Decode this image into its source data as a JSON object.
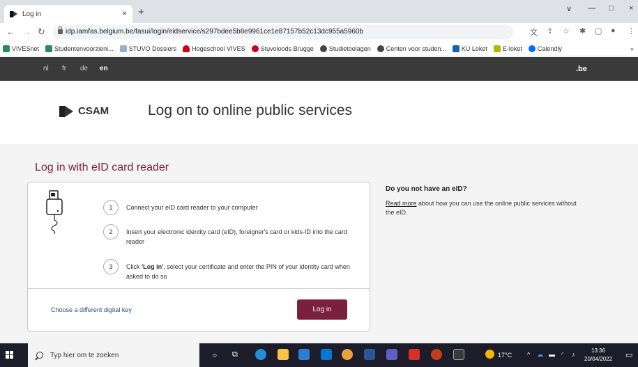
{
  "browser": {
    "tab_title": "Log in",
    "tab_close": "×",
    "new_tab": "+",
    "url": "idp.iamfas.belgium.be/fasui/login/eidservice/s297bdee5b8e9961ce1e87157b52c13dc955a5960b",
    "window_controls": [
      "∨",
      "—",
      "□",
      "×"
    ]
  },
  "bookmarks": [
    {
      "label": "VIVESnet",
      "color": "#2a8a5a"
    },
    {
      "label": "Studentenvoorzieni...",
      "color": "#2a8a5a"
    },
    {
      "label": "STUVO Dossiers",
      "color": "#9ab0c8"
    },
    {
      "label": "Hogeschool VIVES",
      "color": "#d0021b"
    },
    {
      "label": "Stuvoloods Brugge",
      "color": "#d0021b"
    },
    {
      "label": "Studietoelagen",
      "color": "#444444"
    },
    {
      "label": "Centen voor studen...",
      "color": "#444444"
    },
    {
      "label": "KU Loket",
      "color": "#1a5fb4"
    },
    {
      "label": "E-loket",
      "color": "#b5b500"
    },
    {
      "label": "Calendly",
      "color": "#006bff"
    }
  ],
  "site": {
    "languages": [
      "nl",
      "fr",
      "de",
      "en"
    ],
    "active_language": "en",
    "domain_mark": ".be",
    "logo_text": "CSAM",
    "title": "Log on to online public services"
  },
  "main": {
    "heading": "Log in with eID card reader",
    "steps": [
      {
        "num": "1",
        "text": "Connect your eID card reader to your computer"
      },
      {
        "num": "2",
        "text": "Insert your electronic identity card (eID), foreigner's card or kids-ID into the card reader"
      },
      {
        "num": "3",
        "text_prefix": "Click ",
        "text_bold": "'Log in'",
        "text_suffix": ", select your certificate and enter the PIN of your identity card when asked to do so"
      }
    ],
    "alt_key_link": "Choose a different digital key",
    "login_button": "Log in"
  },
  "side": {
    "heading": "Do you not have an eID?",
    "link_text": "Read more",
    "body": " about how you can use the online public services without the eID."
  },
  "taskbar": {
    "search_placeholder": "Typ hier om te zoeken",
    "weather": "17°C",
    "time": "13:36",
    "date": "20/04/2022"
  },
  "colors": {
    "brand": "#7a1f3d",
    "header_dark": "#3a3a3a"
  }
}
